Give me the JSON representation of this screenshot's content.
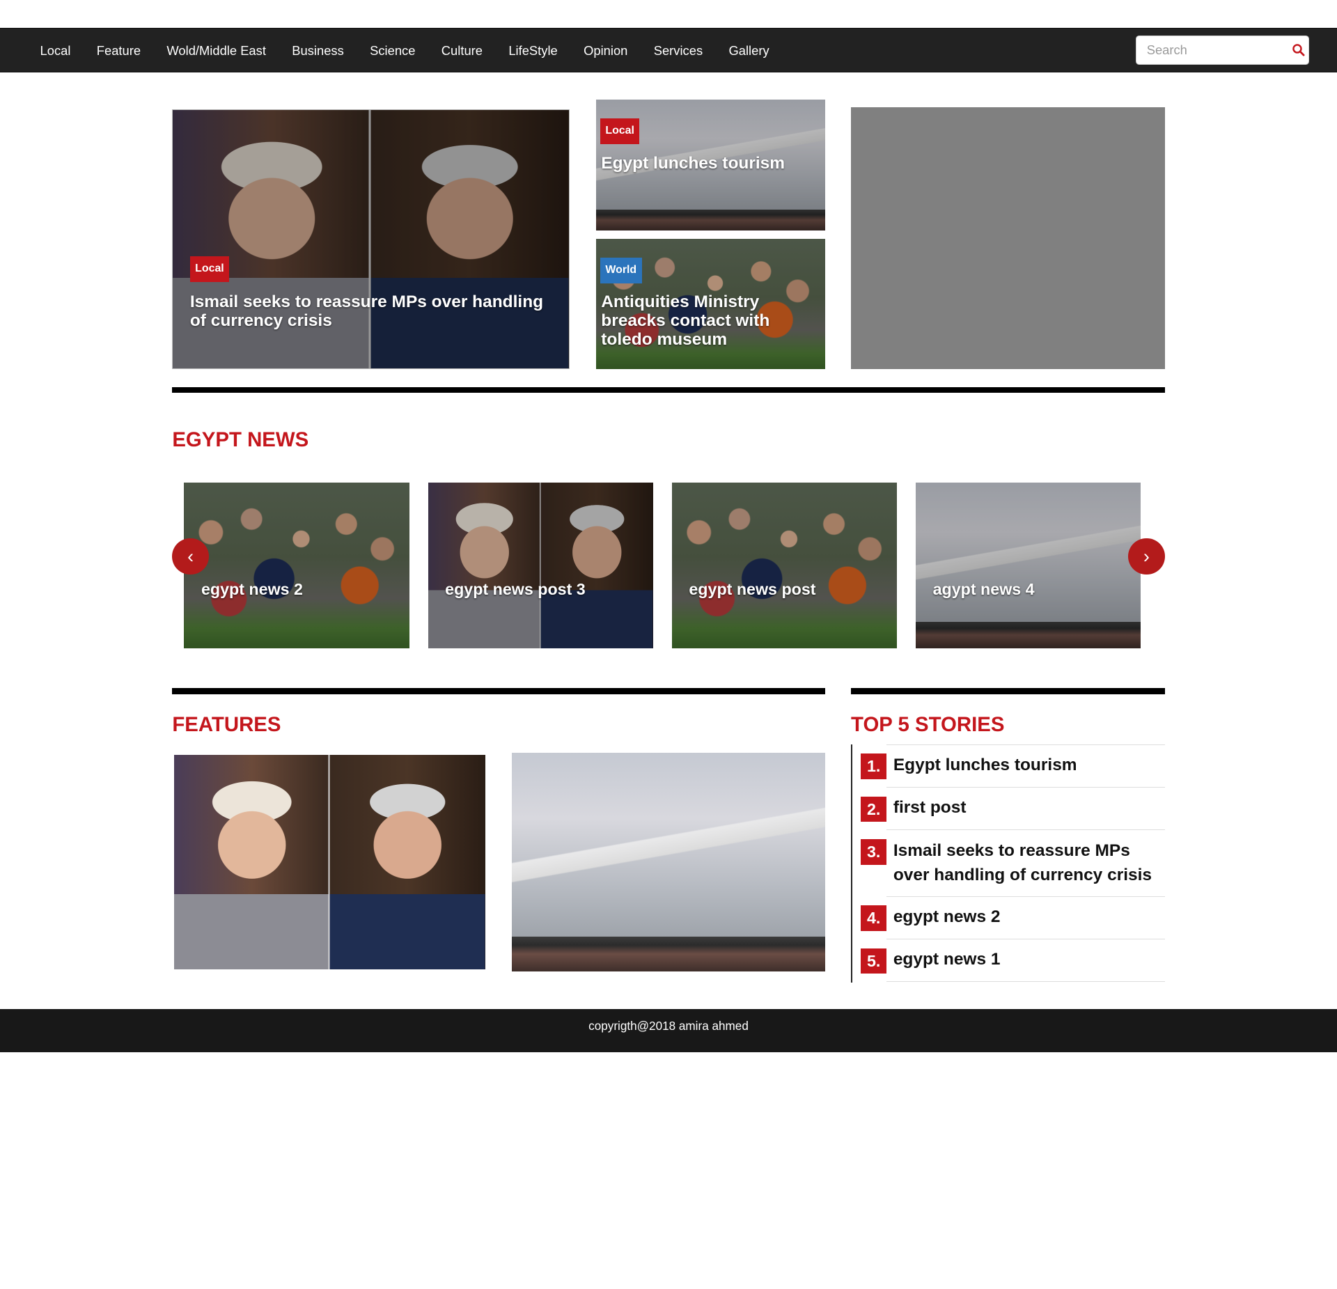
{
  "nav": {
    "items": [
      "Local",
      "Feature",
      "Wold/Middle East",
      "Business",
      "Science",
      "Culture",
      "LifeStyle",
      "Opinion",
      "Services",
      "Gallery"
    ],
    "search_placeholder": "Search"
  },
  "hero": {
    "badge": "Local",
    "title": "Ismail seeks to reassure MPs over handling of currency crisis"
  },
  "side_cards": [
    {
      "badge": "Local",
      "title": "Egypt lunches tourism"
    },
    {
      "badge": "World",
      "title": "Antiquities Ministry breacks contact with toledo museum"
    }
  ],
  "egypt_news": {
    "title": "EGYPT NEWS",
    "prev": "‹",
    "next": "›",
    "slides": [
      "egypt news 2",
      "egypt news post 3",
      "egypt news post",
      "agypt news 4"
    ]
  },
  "features": {
    "title": "FEATURES"
  },
  "top5": {
    "title": "TOP 5 STORIES",
    "items": [
      {
        "num": "1.",
        "text": "Egypt lunches tourism"
      },
      {
        "num": "2.",
        "text": "first post"
      },
      {
        "num": "3.",
        "text": "Ismail seeks to reassure MPs over handling of currency crisis"
      },
      {
        "num": "4.",
        "text": "egypt news 2"
      },
      {
        "num": "5.",
        "text": "egypt news 1"
      }
    ]
  },
  "footer": {
    "text": "copyrigth@2018 amira ahmed"
  },
  "colors": {
    "accent": "#c4161c",
    "world_badge": "#2b74bc",
    "navbar": "#222222",
    "placeholder_box": "#808080"
  }
}
